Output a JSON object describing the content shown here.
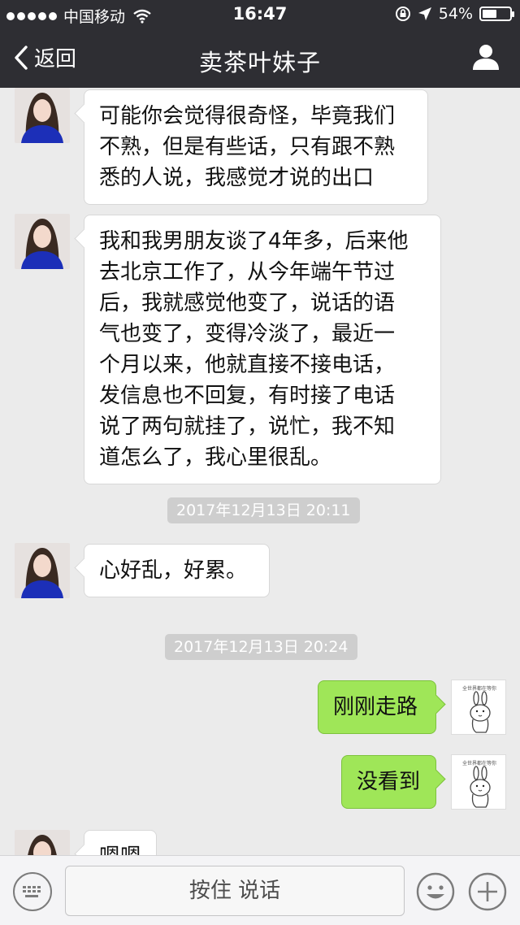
{
  "status_bar": {
    "carrier": "中国移动",
    "time": "16:47",
    "battery_text": "54%",
    "battery_level": 0.54
  },
  "nav": {
    "back_label": "返回",
    "title": "卖茶叶妹子",
    "back_icon": "chevron-left-icon",
    "profile_icon": "person-icon"
  },
  "messages": [
    {
      "side": "in",
      "lines": [
        "可能你会觉得很奇怪，毕竟我们",
        "不熟，但是有些话，只有跟不熟",
        "悉的人说，我感觉才说的出口"
      ]
    },
    {
      "side": "in",
      "lines": [
        "我和我男朋友谈了4年多，后来他",
        "去北京工作了，从今年端午节过",
        "后，我就感觉他变了，说话的语",
        "气也变了，变得冷淡了，最近一",
        "个月以来，他就直接不接电话，",
        "发信息也不回复，有时接了电话",
        "说了两句就挂了，说忙，我不知",
        "道怎么了，我心里很乱。"
      ]
    },
    {
      "type": "time",
      "text": "2017年12月13日 20:11"
    },
    {
      "side": "in",
      "lines": [
        "心好乱，好累。"
      ]
    },
    {
      "type": "time",
      "text": "2017年12月13日 20:24"
    },
    {
      "side": "out",
      "lines": [
        "刚刚走路"
      ]
    },
    {
      "side": "out",
      "lines": [
        "没看到"
      ]
    },
    {
      "side": "in",
      "lines": [
        "嗯嗯"
      ]
    }
  ],
  "input_bar": {
    "voice_label": "按住 说话",
    "keyboard_icon": "keyboard-icon",
    "emoji_icon": "emoji-icon",
    "plus_icon": "plus-icon"
  },
  "colors": {
    "nav_bg": "#2e2e33",
    "chat_bg": "#ebebeb",
    "bubble_out": "#9fe658",
    "bubble_in": "#ffffff"
  }
}
